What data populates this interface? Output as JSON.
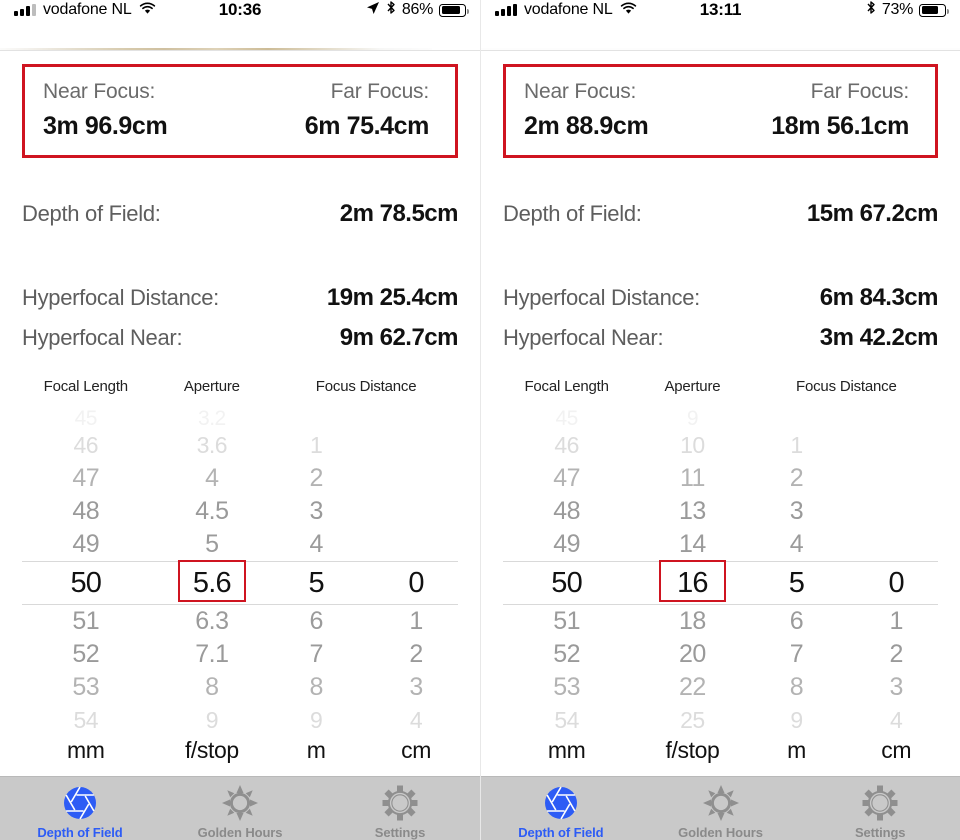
{
  "screens": [
    {
      "id": "left",
      "status": {
        "carrier": "vodafone NL",
        "time": "10:36",
        "battery_pct": "86%",
        "signal_bars": 3,
        "icons": [
          "signal-bars-icon",
          "wifi-icon",
          "location-arrow-icon",
          "bluetooth-icon",
          "battery-icon"
        ]
      },
      "focus": {
        "near_label": "Near Focus:",
        "near_value": "3m 96.9cm",
        "far_label": "Far Focus:",
        "far_value": "6m 75.4cm"
      },
      "results": [
        {
          "label": "Depth of Field:",
          "value": "2m 78.5cm"
        },
        {
          "label": "Hyperfocal Distance:",
          "value": "19m 25.4cm"
        },
        {
          "label": "Hyperfocal Near:",
          "value": "9m 62.7cm"
        }
      ],
      "picker": {
        "headers": [
          "Focal Length",
          "Aperture",
          "Focus Distance"
        ],
        "units": [
          "mm",
          "f/stop",
          "m",
          "cm"
        ],
        "columns": [
          {
            "name": "focal-length",
            "selected": "50",
            "items": [
              "45",
              "46",
              "47",
              "48",
              "49",
              "50",
              "51",
              "52",
              "53",
              "54"
            ]
          },
          {
            "name": "aperture",
            "selected": "5.6",
            "highlighted": true,
            "items": [
              "3.2",
              "3.6",
              "4",
              "4.5",
              "5",
              "5.6",
              "6.3",
              "7.1",
              "8",
              "9"
            ]
          },
          {
            "name": "focus-distance-m",
            "selected": "5",
            "items": [
              "",
              "1",
              "2",
              "3",
              "4",
              "5",
              "6",
              "7",
              "8",
              "9"
            ]
          },
          {
            "name": "focus-distance-cm",
            "selected": "0",
            "items": [
              "",
              "",
              "",
              "",
              "",
              "0",
              "1",
              "2",
              "3",
              "4"
            ]
          }
        ]
      },
      "tabs": [
        {
          "label": "Depth of Field",
          "icon": "aperture-icon",
          "active": true
        },
        {
          "label": "Golden Hours",
          "icon": "sun-icon",
          "active": false
        },
        {
          "label": "Settings",
          "icon": "gear-icon",
          "active": false
        }
      ]
    },
    {
      "id": "right",
      "status": {
        "carrier": "vodafone NL",
        "time": "13:11",
        "battery_pct": "73%",
        "signal_bars": 4,
        "icons": [
          "signal-bars-icon",
          "wifi-icon",
          "bluetooth-icon",
          "battery-icon"
        ]
      },
      "focus": {
        "near_label": "Near Focus:",
        "near_value": "2m 88.9cm",
        "far_label": "Far Focus:",
        "far_value": "18m 56.1cm"
      },
      "results": [
        {
          "label": "Depth of Field:",
          "value": "15m 67.2cm"
        },
        {
          "label": "Hyperfocal Distance:",
          "value": "6m 84.3cm"
        },
        {
          "label": "Hyperfocal Near:",
          "value": "3m 42.2cm"
        }
      ],
      "picker": {
        "headers": [
          "Focal Length",
          "Aperture",
          "Focus Distance"
        ],
        "units": [
          "mm",
          "f/stop",
          "m",
          "cm"
        ],
        "columns": [
          {
            "name": "focal-length",
            "selected": "50",
            "items": [
              "45",
              "46",
              "47",
              "48",
              "49",
              "50",
              "51",
              "52",
              "53",
              "54"
            ]
          },
          {
            "name": "aperture",
            "selected": "16",
            "highlighted": true,
            "items": [
              "9",
              "10",
              "11",
              "13",
              "14",
              "16",
              "18",
              "20",
              "22",
              "25"
            ]
          },
          {
            "name": "focus-distance-m",
            "selected": "5",
            "items": [
              "",
              "1",
              "2",
              "3",
              "4",
              "5",
              "6",
              "7",
              "8",
              "9"
            ]
          },
          {
            "name": "focus-distance-cm",
            "selected": "0",
            "items": [
              "",
              "",
              "",
              "",
              "",
              "0",
              "1",
              "2",
              "3",
              "4"
            ]
          }
        ]
      },
      "tabs": [
        {
          "label": "Depth of Field",
          "icon": "aperture-icon",
          "active": true
        },
        {
          "label": "Golden Hours",
          "icon": "sun-icon",
          "active": false
        },
        {
          "label": "Settings",
          "icon": "gear-icon",
          "active": false
        }
      ]
    }
  ],
  "colors": {
    "highlight_red": "#cf1420",
    "active_blue": "#2d5cf5",
    "tabbar_bg": "#c9c9c9",
    "label_gray": "#5e5e5e"
  }
}
